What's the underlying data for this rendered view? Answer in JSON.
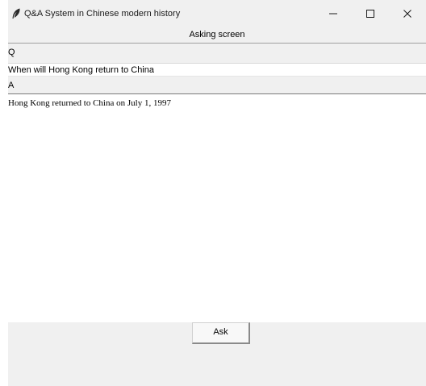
{
  "window": {
    "title": "Q&A System in Chinese modern history",
    "icon": "feather-icon",
    "controls": [
      "minimize-icon",
      "maximize-icon",
      "close-icon"
    ]
  },
  "screen": {
    "title": "Asking screen"
  },
  "question": {
    "label": "Q",
    "value": "When will Hong Kong return to China"
  },
  "answer": {
    "label": "A",
    "value": "Hong Kong returned to China on July 1, 1997"
  },
  "actions": {
    "ask_label": "Ask"
  },
  "colors": {
    "window_bg": "#f0f0f0",
    "field_bg": "#ffffff"
  }
}
